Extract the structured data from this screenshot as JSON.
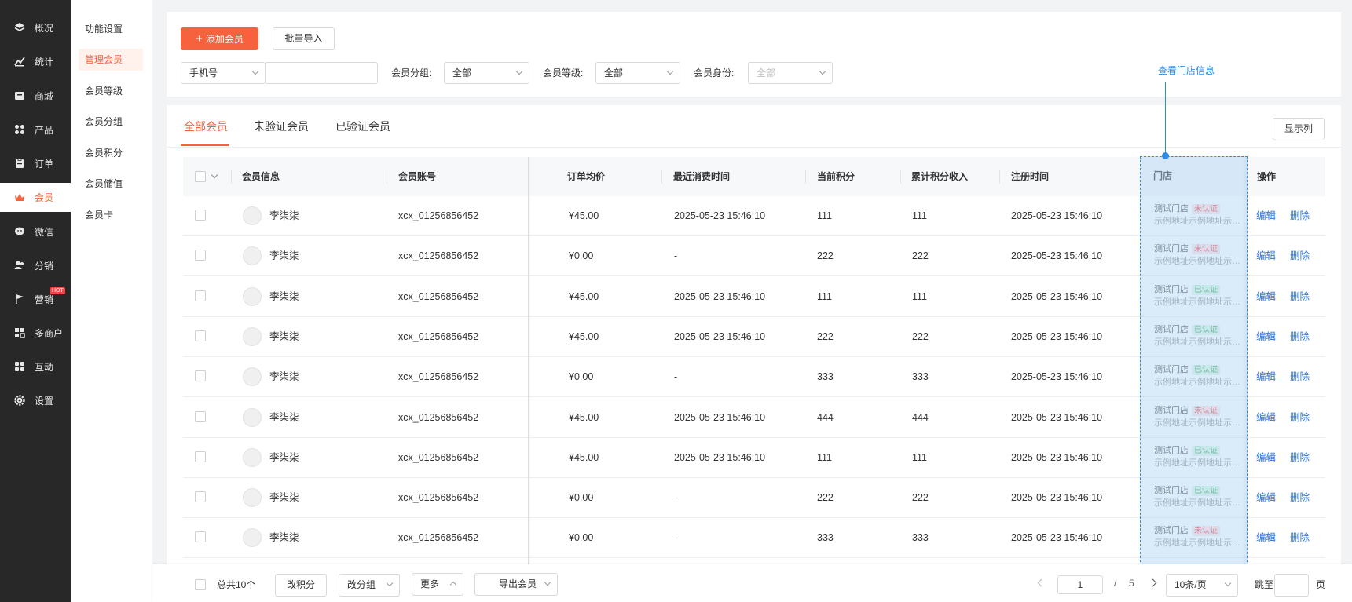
{
  "sidebar": {
    "items": [
      {
        "label": "概况",
        "icon": "layers-icon"
      },
      {
        "label": "统计",
        "icon": "chart-icon"
      },
      {
        "label": "商城",
        "icon": "store-icon"
      },
      {
        "label": "产品",
        "icon": "grid-icon"
      },
      {
        "label": "订单",
        "icon": "clipboard-icon"
      },
      {
        "label": "会员",
        "icon": "crown-icon"
      },
      {
        "label": "微信",
        "icon": "wechat-icon"
      },
      {
        "label": "分销",
        "icon": "users-icon"
      },
      {
        "label": "营销",
        "icon": "flag-icon",
        "badge": "HOT"
      },
      {
        "label": "多商户",
        "icon": "merchant-icon"
      },
      {
        "label": "互动",
        "icon": "apps-icon"
      },
      {
        "label": "设置",
        "icon": "gear-icon"
      }
    ],
    "active_index": 5
  },
  "subnav": {
    "items": [
      "功能设置",
      "管理会员",
      "会员等级",
      "会员分组",
      "会员积分",
      "会员储值",
      "会员卡"
    ],
    "active_index": 1
  },
  "filters": {
    "add_button": "添加会员",
    "import_button": "批量导入",
    "search_type": "手机号",
    "search_placeholder": "",
    "group_label": "会员分组:",
    "group_value": "全部",
    "level_label": "会员等级:",
    "level_value": "全部",
    "identity_label": "会员身份:",
    "identity_value": "全部"
  },
  "tabs": [
    "全部会员",
    "未验证会员",
    "已验证会员"
  ],
  "show_columns_button": "显示列",
  "callout": "查看门店信息",
  "table": {
    "headers": {
      "info": "会员信息",
      "account": "会员账号",
      "avg": "订单均价",
      "last": "最近消费时间",
      "points": "当前积分",
      "total": "累计积分收入",
      "reg": "注册时间",
      "store": "门店",
      "ops": "操作"
    },
    "rows": [
      {
        "name": "李柒柒",
        "account": "xcx_01256856452",
        "avg": "¥45.00",
        "last": "2025-05-23 15:46:10",
        "points": "111",
        "total": "111",
        "reg": "2025-05-23 15:46:10",
        "store": "测试门店",
        "status": "未认证",
        "verified": false,
        "addr": "示例地址示例地址示例地址"
      },
      {
        "name": "李柒柒",
        "account": "xcx_01256856452",
        "avg": "¥0.00",
        "last": "-",
        "points": "222",
        "total": "222",
        "reg": "2025-05-23 15:46:10",
        "store": "测试门店",
        "status": "未认证",
        "verified": false,
        "addr": "示例地址示例地址示例地址"
      },
      {
        "name": "李柒柒",
        "account": "xcx_01256856452",
        "avg": "¥45.00",
        "last": "2025-05-23 15:46:10",
        "points": "111",
        "total": "111",
        "reg": "2025-05-23 15:46:10",
        "store": "测试门店",
        "status": "已认证",
        "verified": true,
        "addr": "示例地址示例地址示例地址"
      },
      {
        "name": "李柒柒",
        "account": "xcx_01256856452",
        "avg": "¥45.00",
        "last": "2025-05-23 15:46:10",
        "points": "222",
        "total": "222",
        "reg": "2025-05-23 15:46:10",
        "store": "测试门店",
        "status": "已认证",
        "verified": true,
        "addr": "示例地址示例地址示例地址"
      },
      {
        "name": "李柒柒",
        "account": "xcx_01256856452",
        "avg": "¥0.00",
        "last": "-",
        "points": "333",
        "total": "333",
        "reg": "2025-05-23 15:46:10",
        "store": "测试门店",
        "status": "已认证",
        "verified": true,
        "addr": "示例地址示例地址示例地址"
      },
      {
        "name": "李柒柒",
        "account": "xcx_01256856452",
        "avg": "¥45.00",
        "last": "2025-05-23 15:46:10",
        "points": "444",
        "total": "444",
        "reg": "2025-05-23 15:46:10",
        "store": "测试门店",
        "status": "未认证",
        "verified": false,
        "addr": "示例地址示例地址示例地址"
      },
      {
        "name": "李柒柒",
        "account": "xcx_01256856452",
        "avg": "¥45.00",
        "last": "2025-05-23 15:46:10",
        "points": "111",
        "total": "111",
        "reg": "2025-05-23 15:46:10",
        "store": "测试门店",
        "status": "已认证",
        "verified": true,
        "addr": "示例地址示例地址示例地址"
      },
      {
        "name": "李柒柒",
        "account": "xcx_01256856452",
        "avg": "¥0.00",
        "last": "-",
        "points": "222",
        "total": "222",
        "reg": "2025-05-23 15:46:10",
        "store": "测试门店",
        "status": "已认证",
        "verified": true,
        "addr": "示例地址示例地址示例地址"
      },
      {
        "name": "李柒柒",
        "account": "xcx_01256856452",
        "avg": "¥0.00",
        "last": "-",
        "points": "333",
        "total": "333",
        "reg": "2025-05-23 15:46:10",
        "store": "测试门店",
        "status": "未认证",
        "verified": false,
        "addr": "示例地址示例地址示例地址"
      }
    ],
    "edit_label": "编辑",
    "delete_label": "删除"
  },
  "footer": {
    "total_text": "总共10个",
    "change_points": "改积分",
    "change_group": "改分组",
    "more": "更多",
    "export": "导出会员",
    "page_current": "1",
    "page_sep": "/",
    "page_total": "5",
    "page_size": "10条/页",
    "jump_label": "跳至",
    "jump_value": "",
    "page_unit": "页"
  },
  "colors": {
    "accent": "#f5623d",
    "link": "#2b72d8",
    "sidebar_bg": "#282828",
    "verified": "#2fa84f",
    "unverified": "#f5454a"
  }
}
